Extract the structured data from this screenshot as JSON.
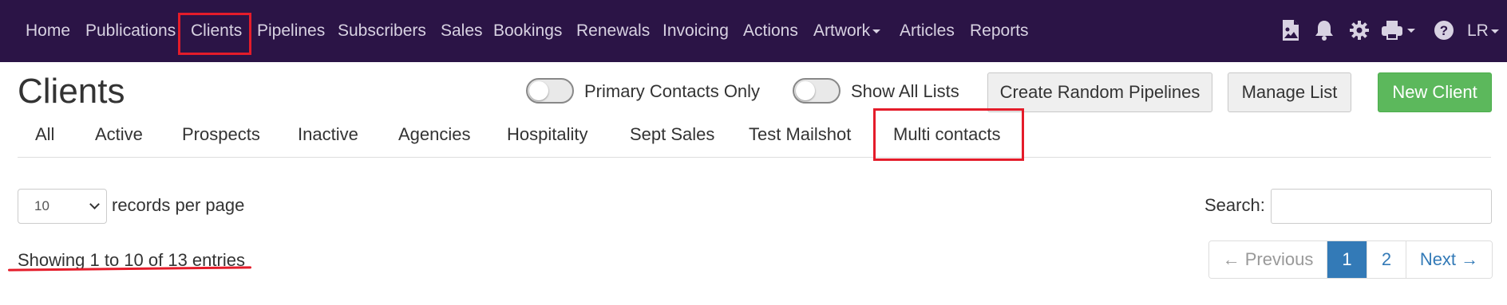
{
  "nav": {
    "items": [
      "Home",
      "Publications",
      "Clients",
      "Pipelines",
      "Subscribers",
      "Sales",
      "Bookings",
      "Renewals",
      "Invoicing",
      "Actions",
      "Artwork",
      "Articles",
      "Reports"
    ],
    "user": "LR",
    "icons": [
      "image-icon",
      "bell-icon",
      "gear-icon",
      "printer-icon",
      "help-icon"
    ]
  },
  "page": {
    "title": "Clients"
  },
  "toggles": {
    "primary_contacts": "Primary Contacts Only",
    "show_all_lists": "Show All Lists"
  },
  "buttons": {
    "create_random": "Create Random Pipelines",
    "manage_list": "Manage List",
    "new_client": "New Client"
  },
  "tabs": [
    "All",
    "Active",
    "Prospects",
    "Inactive",
    "Agencies",
    "Hospitality",
    "Sept Sales",
    "Test Mailshot",
    "Multi contacts"
  ],
  "table_controls": {
    "page_size": "10",
    "records_per_page": "records per page",
    "search_label": "Search:",
    "info": "Showing 1 to 10 of 13 entries"
  },
  "pagination": {
    "prev": "← Previous",
    "pages": [
      "1",
      "2"
    ],
    "next": "Next →"
  },
  "colors": {
    "nav_bg": "#2b1446",
    "highlight": "#e41c2a",
    "success": "#5cb85c",
    "primary": "#337ab7"
  }
}
